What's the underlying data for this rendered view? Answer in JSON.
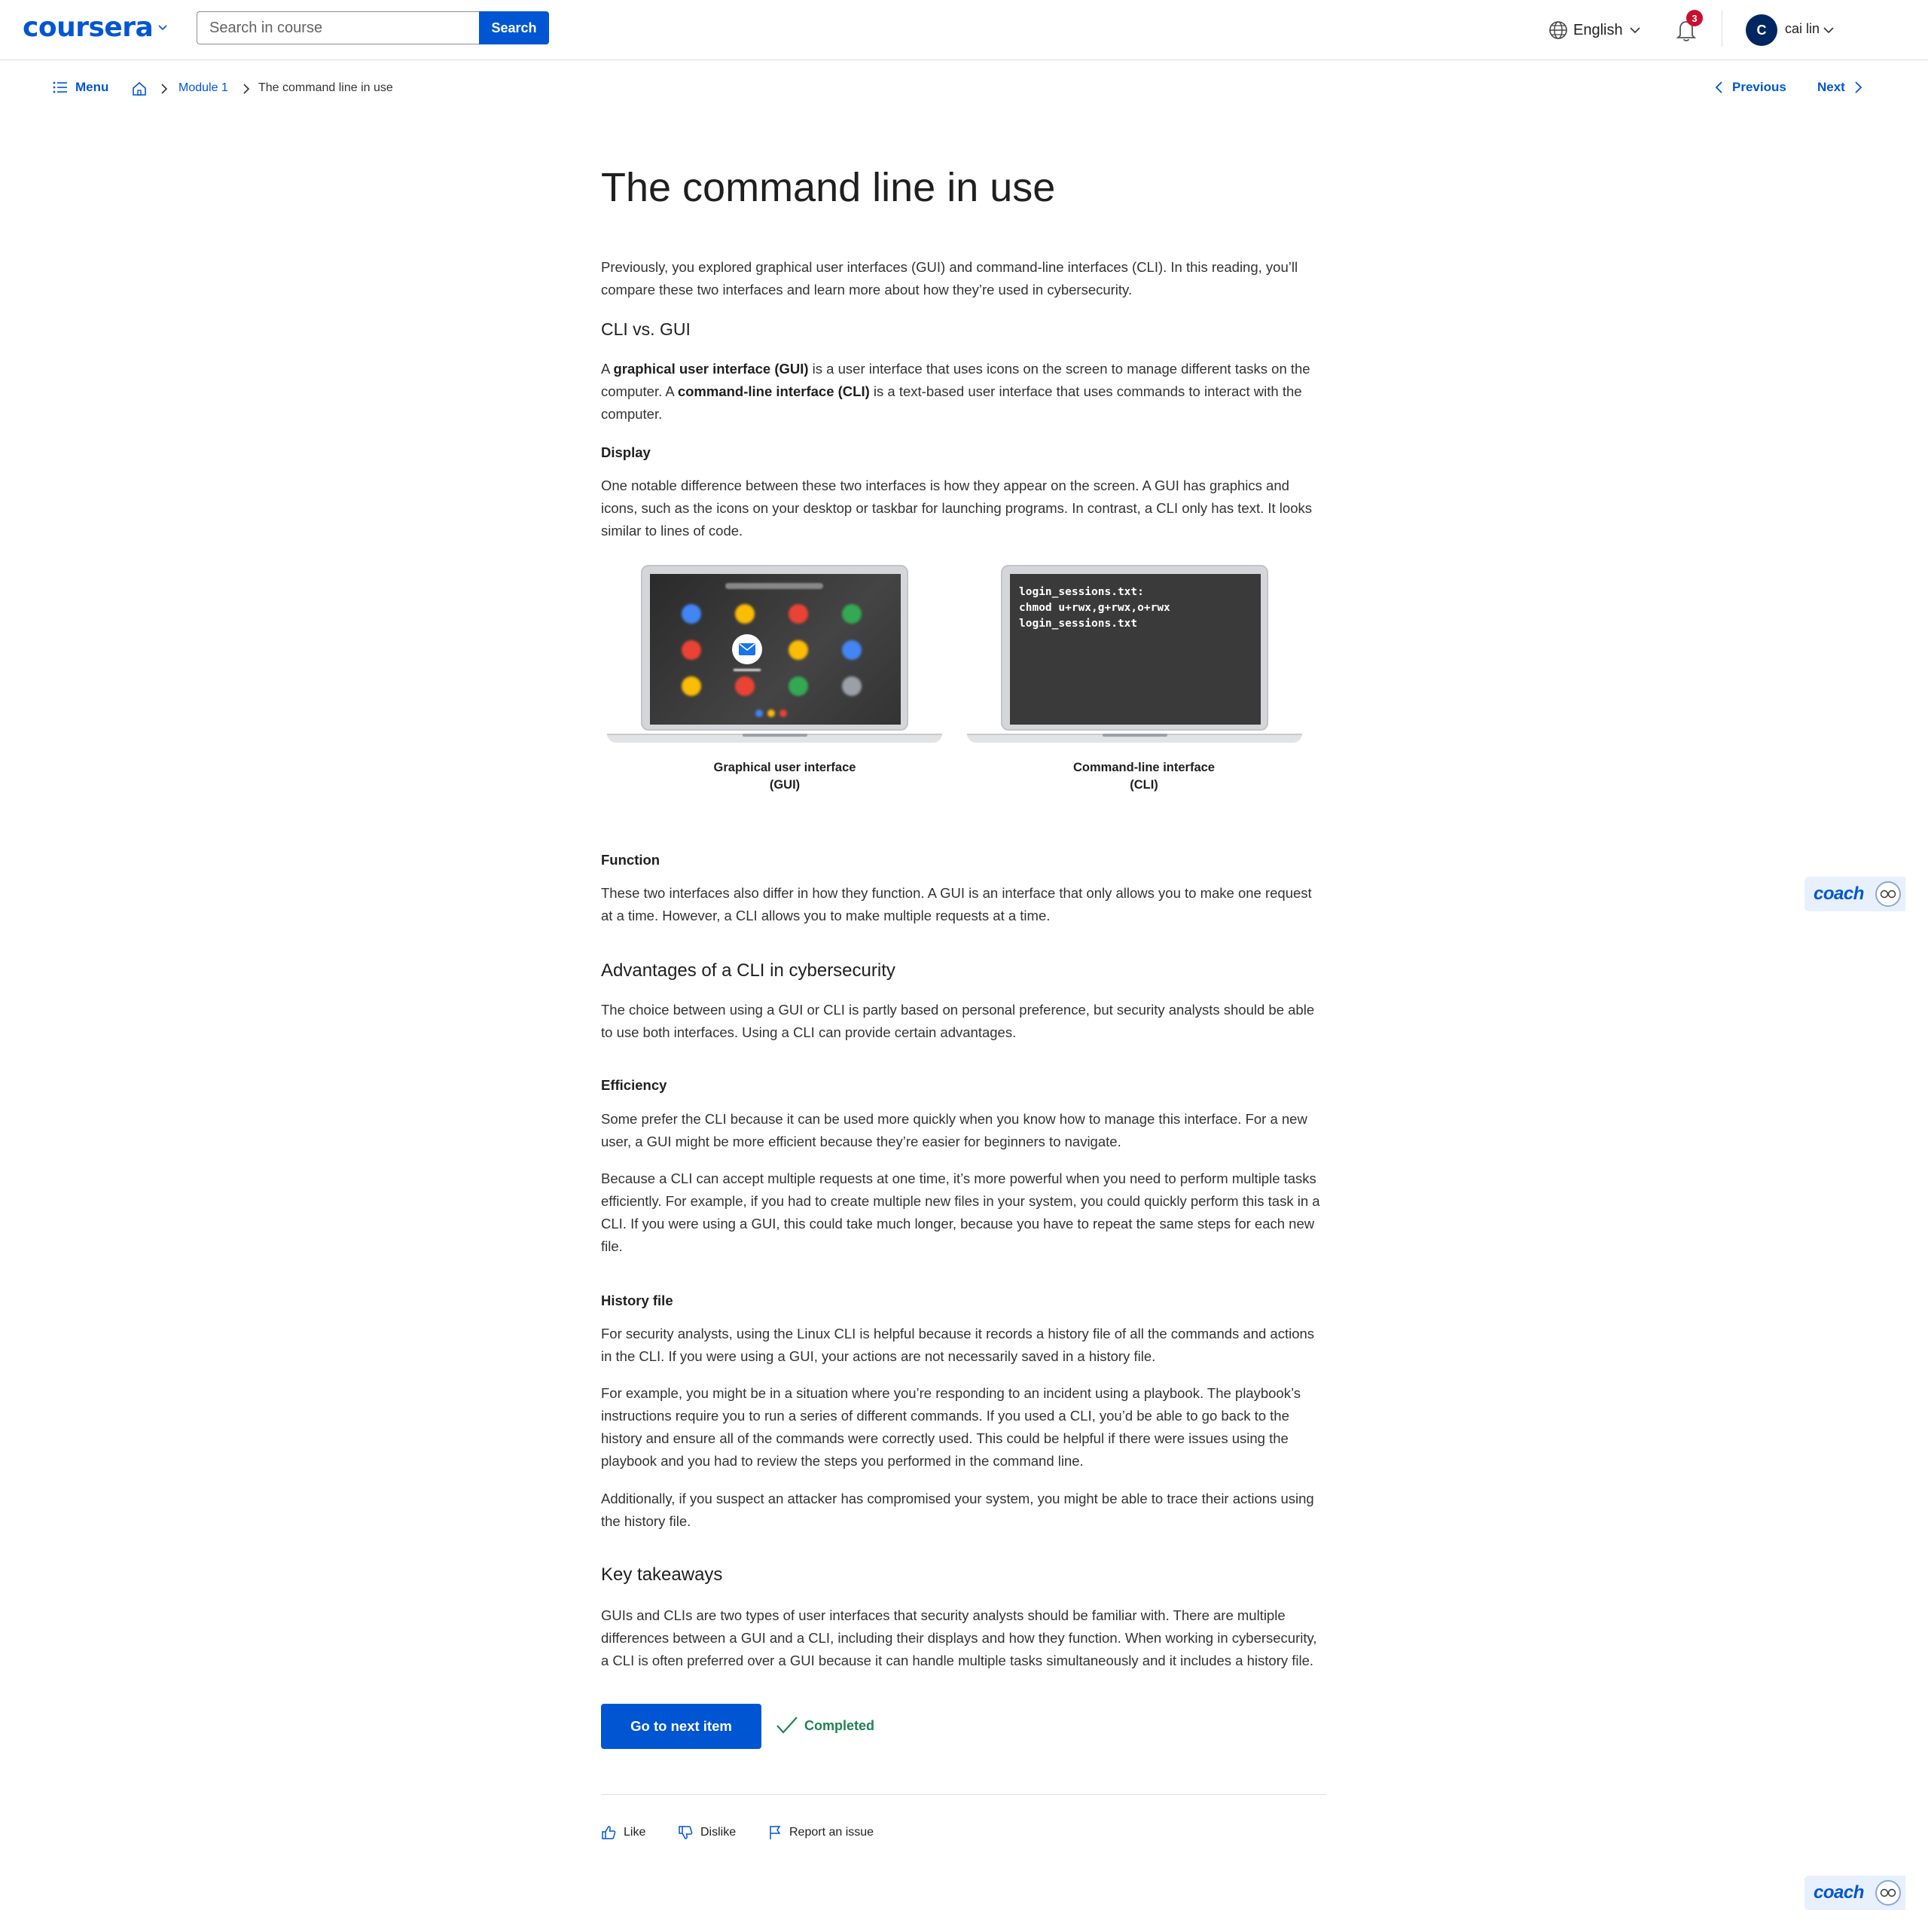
{
  "header": {
    "logo": "coursera",
    "search": {
      "placeholder": "Search in course",
      "button_label": "Search"
    },
    "language": "English",
    "notifications_count": "3",
    "user": {
      "initial": "C",
      "name": "cai lin"
    }
  },
  "subnav": {
    "menu_label": "Menu",
    "breadcrumb": {
      "module": "Module 1",
      "current": "The command line in use"
    },
    "previous_label": "Previous",
    "next_label": "Next"
  },
  "article": {
    "title": "The command line in use",
    "intro": "Previously, you explored graphical user interfaces (GUI) and command-line interfaces (CLI). In this reading, you’ll compare these two interfaces and learn more about how they’re used in cybersecurity.",
    "section1_heading": "CLI vs. GUI",
    "definition": {
      "p1": "A ",
      "gui_term": "graphical user interface (GUI)",
      "p2": " is a user interface that uses icons on the screen to manage different tasks on the computer. A ",
      "cli_term": "command-line interface (CLI)",
      "p3": " is a text-based user interface that uses commands to interact with the computer."
    },
    "display_heading": "Display",
    "display_text": "One notable difference between these two interfaces is how they appear on the screen. A GUI has graphics and icons, such as the icons on your desktop or taskbar for launching programs. In contrast, a CLI only has text. It looks similar to lines of code.",
    "figure": {
      "gui_caption_line1": "Graphical user interface",
      "gui_caption_line2": "(GUI)",
      "cli_caption_line1": "Command-line interface",
      "cli_caption_line2": "(CLI)",
      "cli_terminal_text": "login_sessions.txt:\nchmod u+rwx,g+rwx,o+rwx\nlogin_sessions.txt"
    },
    "function_heading": "Function",
    "function_text": "These two interfaces also differ in how they function. A GUI is an interface that only allows you to make one request at a time. However, a CLI allows you to make multiple requests at a time.",
    "section2_heading": "Advantages of a CLI in cybersecurity",
    "advantages_text": "The choice between using a GUI or CLI is partly based on personal preference, but security analysts should be able to use both interfaces. Using a CLI can provide certain advantages.",
    "efficiency_heading": "Efficiency",
    "efficiency_p1": "Some prefer the CLI because it can be used more quickly when you know how to manage this interface. For a new user, a GUI might be more efficient because they’re easier for beginners to navigate.",
    "efficiency_p2": "Because a CLI can accept multiple requests at one time, it’s more powerful when you need to perform multiple tasks efficiently. For example, if you had to create multiple new files in your system, you could quickly perform this task in a CLI. If you were using a GUI, this could take much longer, because you have to repeat the same steps for each new file.",
    "history_heading": "History file",
    "history_p1": "For security analysts, using the Linux CLI is helpful because it records a history file of all the commands and actions in the CLI. If you were using a GUI, your actions are not necessarily saved in a history file.",
    "history_p2": "For example, you might be in a situation where you’re responding to an incident using a playbook. The playbook’s instructions require you to run a series of different commands. If you used a CLI, you’d be able to go back to the history and ensure all of the commands were correctly used. This could be helpful if there were issues using the playbook and you had to review the steps you performed in the command line.",
    "history_p3": "Additionally, if you suspect an attacker has compromised your system, you might be able to trace their actions using the history file.",
    "takeaways_heading": "Key takeaways",
    "takeaways_text": "GUIs and CLIs are two types of user interfaces that security analysts should be familiar with. There are multiple differences between a GUI and a CLI, including their displays and how they function. When working in cybersecurity, a CLI is often preferred over a GUI because it can handle multiple tasks simultaneously and it includes a history file."
  },
  "actions": {
    "next_item_label": "Go to next item",
    "completed_label": "Completed",
    "like_label": "Like",
    "dislike_label": "Dislike",
    "report_label": "Report an issue"
  },
  "coach": {
    "label": "coach"
  },
  "colors": {
    "brand": "#0056d2",
    "completed": "#1f8354",
    "badge": "#c8102e",
    "avatar": "#002761"
  }
}
